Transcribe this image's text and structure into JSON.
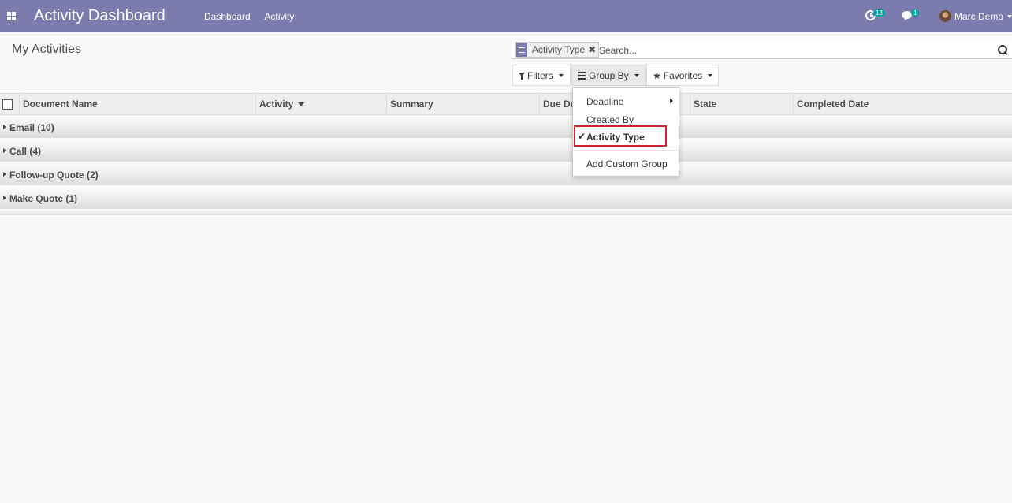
{
  "navbar": {
    "brand": "Activity Dashboard",
    "menu": [
      "Dashboard",
      "Activity"
    ],
    "activity_count": "13",
    "message_count": "1",
    "user_name": "Marc Demo"
  },
  "control_panel": {
    "breadcrumb": "My Activities",
    "facet_value": "Activity Type",
    "facet_remove": "✖",
    "search_placeholder": "Search...",
    "filters_label": "Filters",
    "groupby_label": "Group By",
    "favorites_label": "Favorites"
  },
  "table": {
    "columns": [
      "Document Name",
      "Activity",
      "Summary",
      "Due Date",
      "State",
      "Completed Date"
    ],
    "groups": [
      "Email (10)",
      "Call (4)",
      "Follow-up Quote (2)",
      "Make Quote (1)"
    ]
  },
  "groupby_menu": {
    "items": [
      "Deadline",
      "Created By",
      "Activity Type",
      "Add Custom Group"
    ],
    "selected": "Activity Type",
    "highlight_color": "#d0222b"
  },
  "colors": {
    "navbar": "#7c7bad",
    "badge": "#00a09d"
  }
}
